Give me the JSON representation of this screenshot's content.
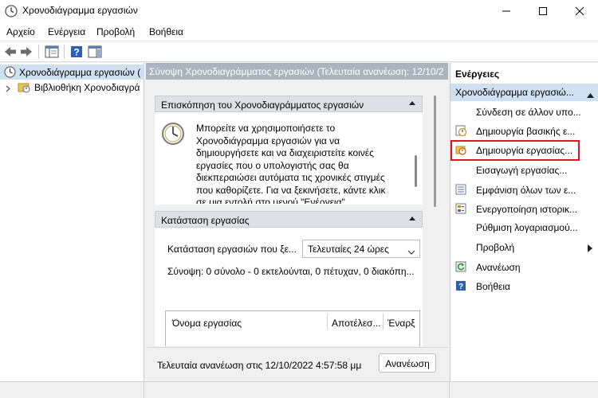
{
  "window": {
    "title": "Χρονοδιάγραμμα εργασιών"
  },
  "menu": [
    "Αρχείο",
    "Ενέργεια",
    "Προβολή",
    "Βοήθεια"
  ],
  "tree": {
    "root": "Χρονοδιάγραμμα εργασιών (",
    "child": "Βιβλιοθήκη Χρονοδιαγρά"
  },
  "center": {
    "header": "Σύνοψη Χρονοδιαγράμματος εργασιών (Τελευταία ανανέωση: 12/10/2",
    "overview": {
      "title": "Επισκόπηση του Χρονοδιαγράμματος εργασιών",
      "lines": [
        "Μπορείτε να χρησιμοποιήσετε το",
        "Χρονοδιάγραμμα εργασιών για να",
        "δημιουργήσετε και να διαχειριστείτε κοινές",
        "εργασίες που ο υπολογιστής σας θα",
        "διεκπεραιώσει αυτόματα τις χρονικές στιγμές",
        "που καθορίζετε. Για να ξεκινήσετε, κάντε κλικ",
        "σε μια εντολή στο μενού \"Ενέργεια\""
      ]
    },
    "status": {
      "title": "Κατάσταση εργασίας",
      "label": "Κατάσταση εργασιών που ξε...",
      "select_value": "Τελευταίες 24 ώρες",
      "summary": "Σύνοψη: 0 σύνολο - 0 εκτελούνται, 0 πέτυχαν, 0 διακόπη...",
      "columns": [
        "Όνομα εργασίας",
        "Αποτέλεσ...",
        "Έναρξ"
      ]
    },
    "footer": {
      "last_refresh": "Τελευταία ανανέωση στις 12/10/2022 4:57:58 μμ",
      "refresh_button": "Ανανέωση"
    }
  },
  "actions": {
    "title": "Ενέργειες",
    "section": "Χρονοδιάγραμμα εργασιώ...",
    "items": [
      {
        "label": "Σύνδεση σε άλλον υπο...",
        "icon": "none"
      },
      {
        "label": "Δημιουργία βασικής ε...",
        "icon": "clock-task-icon"
      },
      {
        "label": "Δημιουργία εργασίας...",
        "icon": "folder-clock-icon",
        "highlighted": true
      },
      {
        "label": "Εισαγωγή εργασίας...",
        "icon": "none"
      },
      {
        "label": "Εμφάνιση όλων των ε...",
        "icon": "list-tasks-icon"
      },
      {
        "label": "Ενεργοποίηση ιστορικ...",
        "icon": "history-icon"
      },
      {
        "label": "Ρύθμιση λογαριασμού...",
        "icon": "none"
      },
      {
        "label": "Προβολή",
        "icon": "none",
        "submenu": true
      },
      {
        "label": "Ανανέωση",
        "icon": "refresh-icon"
      },
      {
        "label": "Βοήθεια",
        "icon": "help-icon"
      }
    ]
  },
  "colors": {
    "highlight_border": "#e0141e",
    "center_header_bg": "#aab4bf",
    "selected_bg": "#cfe0f0"
  }
}
